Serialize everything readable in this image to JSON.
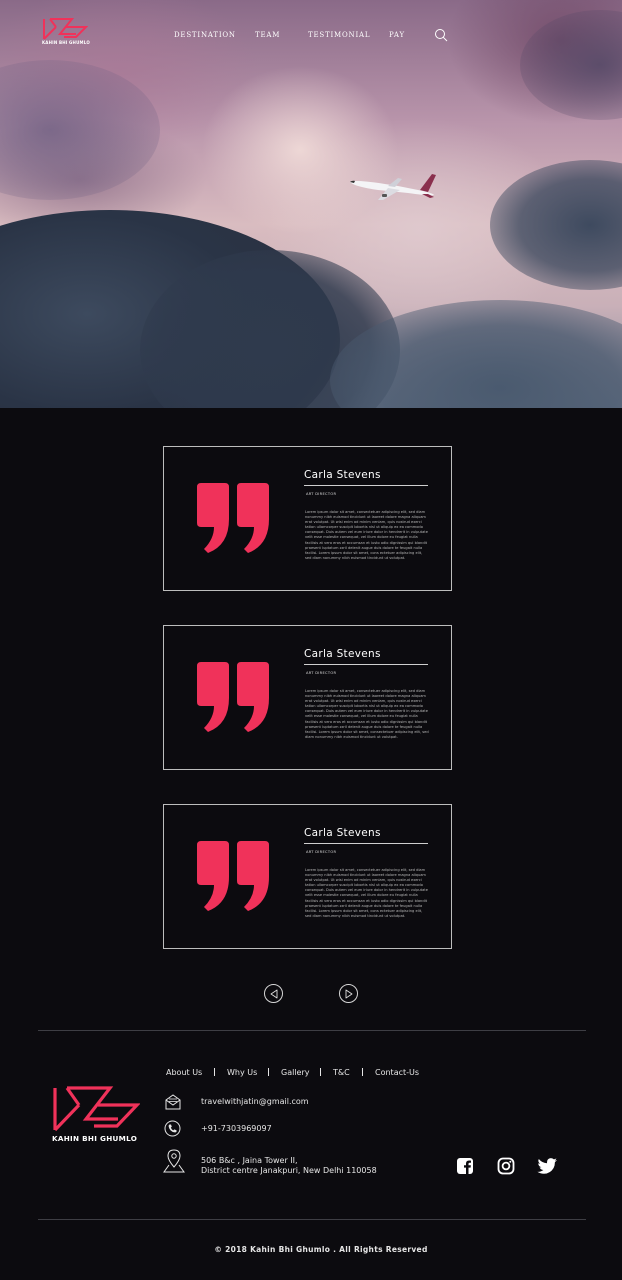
{
  "nav": {
    "brand": "KAHIN BHI GHUMLO",
    "links": [
      "DESTINATION",
      "TEAM",
      "TESTIMONIAL",
      "PAY"
    ],
    "search_icon": "search-icon"
  },
  "hero": {
    "image": "airplane-in-cloudy-sky"
  },
  "testimonials": [
    {
      "name": "Carla Stevens",
      "role": "ART DIRECTOR",
      "text": "Lorem ipsum dolor sit amet, consectetuer adipiscing elit, sed diam nonummy nibh euismod tincidunt ut laoreet dolore magna aliquam erat volutpat. Ut wisi enim ad minim veniam, quis nostrud exerci tation ullamcorper suscipit lobortis nisl ut aliquip ex ea commodo consequat. Duis autem vel eum iriure dolor in hendrerit in vulputate velit esse molestie consequat, vel illum dolore eu feugiat nulla facilisis at vero eros et accumsan et iusto odio dignissim qui blandit praesent luptatum zzril delenit augue duis dolore te feugait nulla facilisi. Lorem ipsum dolor sit amet, cons ectetuer adipiscing elit, sed diam nonummy nibh euismod tincidunt ut volutpat."
    },
    {
      "name": "Carla Stevens",
      "role": "ART DIRECTOR",
      "text": "Lorem ipsum dolor sit amet, consectetuer adipiscing elit, sed diam nonummy nibh euismod tincidunt ut laoreet dolore magna aliquam erat volutpat. Ut wisi enim ad minim veniam, quis nostrud exerci tation ullamcorper suscipit lobortis nisl ut aliquip ex ea commodo consequat. Duis autem vel eum iriure dolor in hendrerit in vulputate velit esse molestie consequat, vel illum dolore eu feugiat nulla facilisis at vero eros et accumsan et iusto odio dignissim qui blandit praesent luptatum zzril delenit augue duis dolore te feugait nulla facilisi. Lorem ipsum dolor sit amet, consectetuer adipiscing elit, sed diam nonummy nibh euismod tincidunt ut volutpat."
    },
    {
      "name": "Carla Stevens",
      "role": "ART DIRECTOR",
      "text": "Lorem ipsum dolor sit amet, consectetuer adipiscing elit, sed diam nonummy nibh euismod tincidunt ut laoreet dolore magna aliquam erat volutpat. Ut wisi enim ad minim veniam, quis nostrud exerci tation ullamcorper suscipit lobortis nisl ut aliquip ex ea commodo consequat. Duis autem vel eum iriure dolor in hendrerit in vulputate velit esse molestie consequat, vel illum dolore eu feugiat nulla facilisis at vero eros et accumsan et iusto odio dignissim qui blandit praesent luptatum zzril delenit augue duis dolore te feugait nulla facilisi. Lorem ipsum dolor sit amet, cons ectetuer adipiscing elit, sed diam nonummy nibh euismod tincidunt ut volutpat."
    }
  ],
  "pager": {
    "prev_icon": "play-left-icon",
    "next_icon": "play-right-icon"
  },
  "footer": {
    "brand": "KAHIN BHI GHUMLO",
    "links": [
      "About Us",
      "Why Us",
      "Gallery",
      "T&C",
      "Contact-Us"
    ],
    "email": "travelwithjatin@gmail.com",
    "phone": "+91-7303969097",
    "address_line1": "506 B&c , Jaina Tower II,",
    "address_line2": "District centre Janakpuri, New Delhi 110058",
    "social": [
      "facebook-icon",
      "instagram-icon",
      "twitter-icon"
    ],
    "copyright": "© 2018 Kahin Bhi Ghumlo . All Rights Reserved"
  },
  "colors": {
    "accent": "#f0325a",
    "background": "#0c0b0f",
    "border": "#bdbdbd"
  }
}
